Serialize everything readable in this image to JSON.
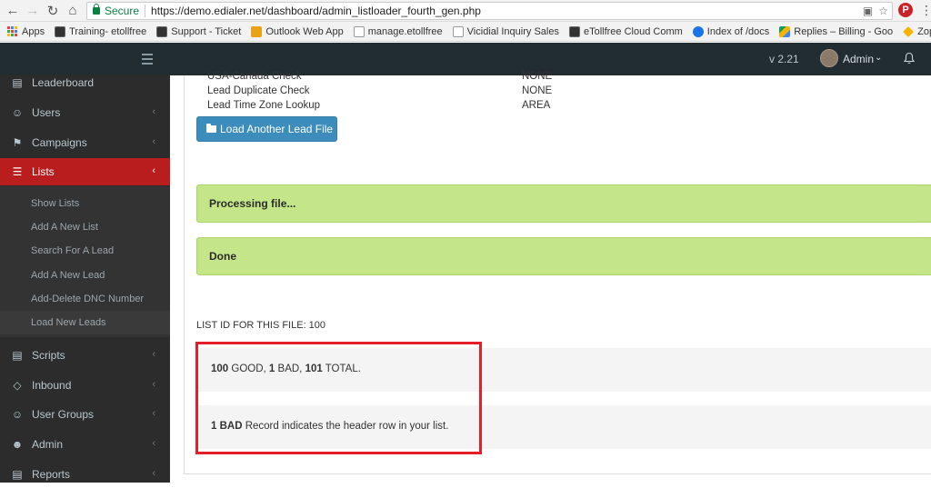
{
  "browser": {
    "secure_label": "Secure",
    "url": "https://demo.edialer.net/dashboard/admin_listloader_fourth_gen.php",
    "pinterest": "P"
  },
  "bookmarks": [
    {
      "label": "Apps",
      "color": "#4285f4"
    },
    {
      "label": "Training- etollfree",
      "color": "#333333"
    },
    {
      "label": "Support - Ticket",
      "color": "#333333"
    },
    {
      "label": "Outlook Web App",
      "color": "#e8a317"
    },
    {
      "label": "manage.etollfree",
      "color": "#ffffff"
    },
    {
      "label": "Vicidial Inquiry Sales",
      "color": "#ffffff"
    },
    {
      "label": "eTollfree Cloud Comm",
      "color": "#333333"
    },
    {
      "label": "Index of /docs",
      "color": "#1a73e8"
    },
    {
      "label": "Replies – Billing - Goo",
      "color": "#0f9d58"
    },
    {
      "label": "Zopim Dashboard - H",
      "color": "#f4b400"
    }
  ],
  "topbar": {
    "version": "v 2.21",
    "user": "Admin"
  },
  "sidebar": {
    "items": [
      {
        "label": "Leaderboard",
        "icon": "bar-chart-icon"
      },
      {
        "label": "Users",
        "icon": "users-icon"
      },
      {
        "label": "Campaigns",
        "icon": "flag-icon"
      },
      {
        "label": "Lists",
        "icon": "list-icon"
      },
      {
        "label": "Scripts",
        "icon": "file-icon"
      },
      {
        "label": "Inbound",
        "icon": "diamond-icon"
      },
      {
        "label": "User Groups",
        "icon": "user-group-icon"
      },
      {
        "label": "Admin",
        "icon": "admin-icon"
      },
      {
        "label": "Reports",
        "icon": "report-icon"
      }
    ],
    "submenu": [
      "Show Lists",
      "Add A New List",
      "Search For A Lead",
      "Add A New Lead",
      "Add-Delete DNC Number",
      "Load New Leads"
    ]
  },
  "settings": [
    {
      "key": "USA-Canada Check",
      "value": "NONE"
    },
    {
      "key": "Lead Duplicate Check",
      "value": "NONE"
    },
    {
      "key": "Lead Time Zone Lookup",
      "value": "AREA"
    }
  ],
  "load_button_label": "Load Another Lead File",
  "alerts": {
    "processing": "Processing file...",
    "done": "Done"
  },
  "list_id_text": "LIST ID FOR THIS FILE: 100",
  "results": {
    "good_count": "100",
    "good_label": " GOOD, ",
    "bad_count": "1",
    "bad_label": " BAD, ",
    "total_count": "101",
    "total_label": " TOTAL.",
    "note_bold": "1 BAD",
    "note_text": " Record indicates the header row in your list."
  },
  "colors": {
    "active_menu": "#b91d1d",
    "alert_bg": "#c5e688",
    "primary_button": "#3c8dbc",
    "highlight_border": "#e3202a"
  }
}
